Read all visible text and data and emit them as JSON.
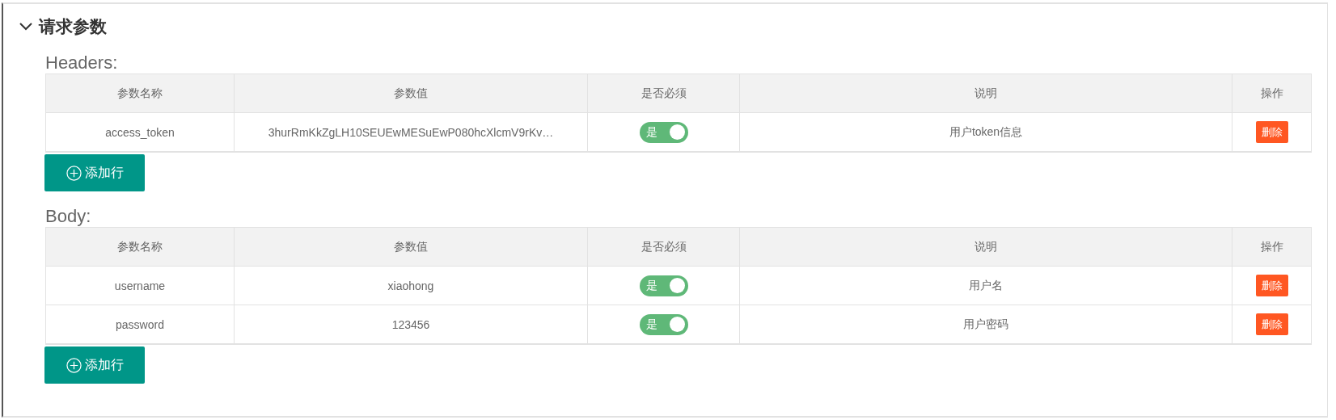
{
  "section": {
    "title": "请求参数",
    "expanded": true
  },
  "tables": [
    {
      "label": "Headers:",
      "columns": [
        "参数名称",
        "参数值",
        "是否必须",
        "说明",
        "操作"
      ],
      "rows": [
        {
          "name": "access_token",
          "value": "3hurRmKkZgLH10SEUEwMESuEwP080hcXlcmV9rKv…",
          "required": {
            "on": true,
            "text": "是"
          },
          "description": "用户token信息",
          "action": "删除"
        }
      ],
      "add_button": "添加行"
    },
    {
      "label": "Body:",
      "columns": [
        "参数名称",
        "参数值",
        "是否必须",
        "说明",
        "操作"
      ],
      "rows": [
        {
          "name": "username",
          "value": "xiaohong",
          "required": {
            "on": true,
            "text": "是"
          },
          "description": "用户名",
          "action": "删除"
        },
        {
          "name": "password",
          "value": "123456",
          "required": {
            "on": true,
            "text": "是"
          },
          "description": "用户密码",
          "action": "删除"
        }
      ],
      "add_button": "添加行"
    }
  ]
}
